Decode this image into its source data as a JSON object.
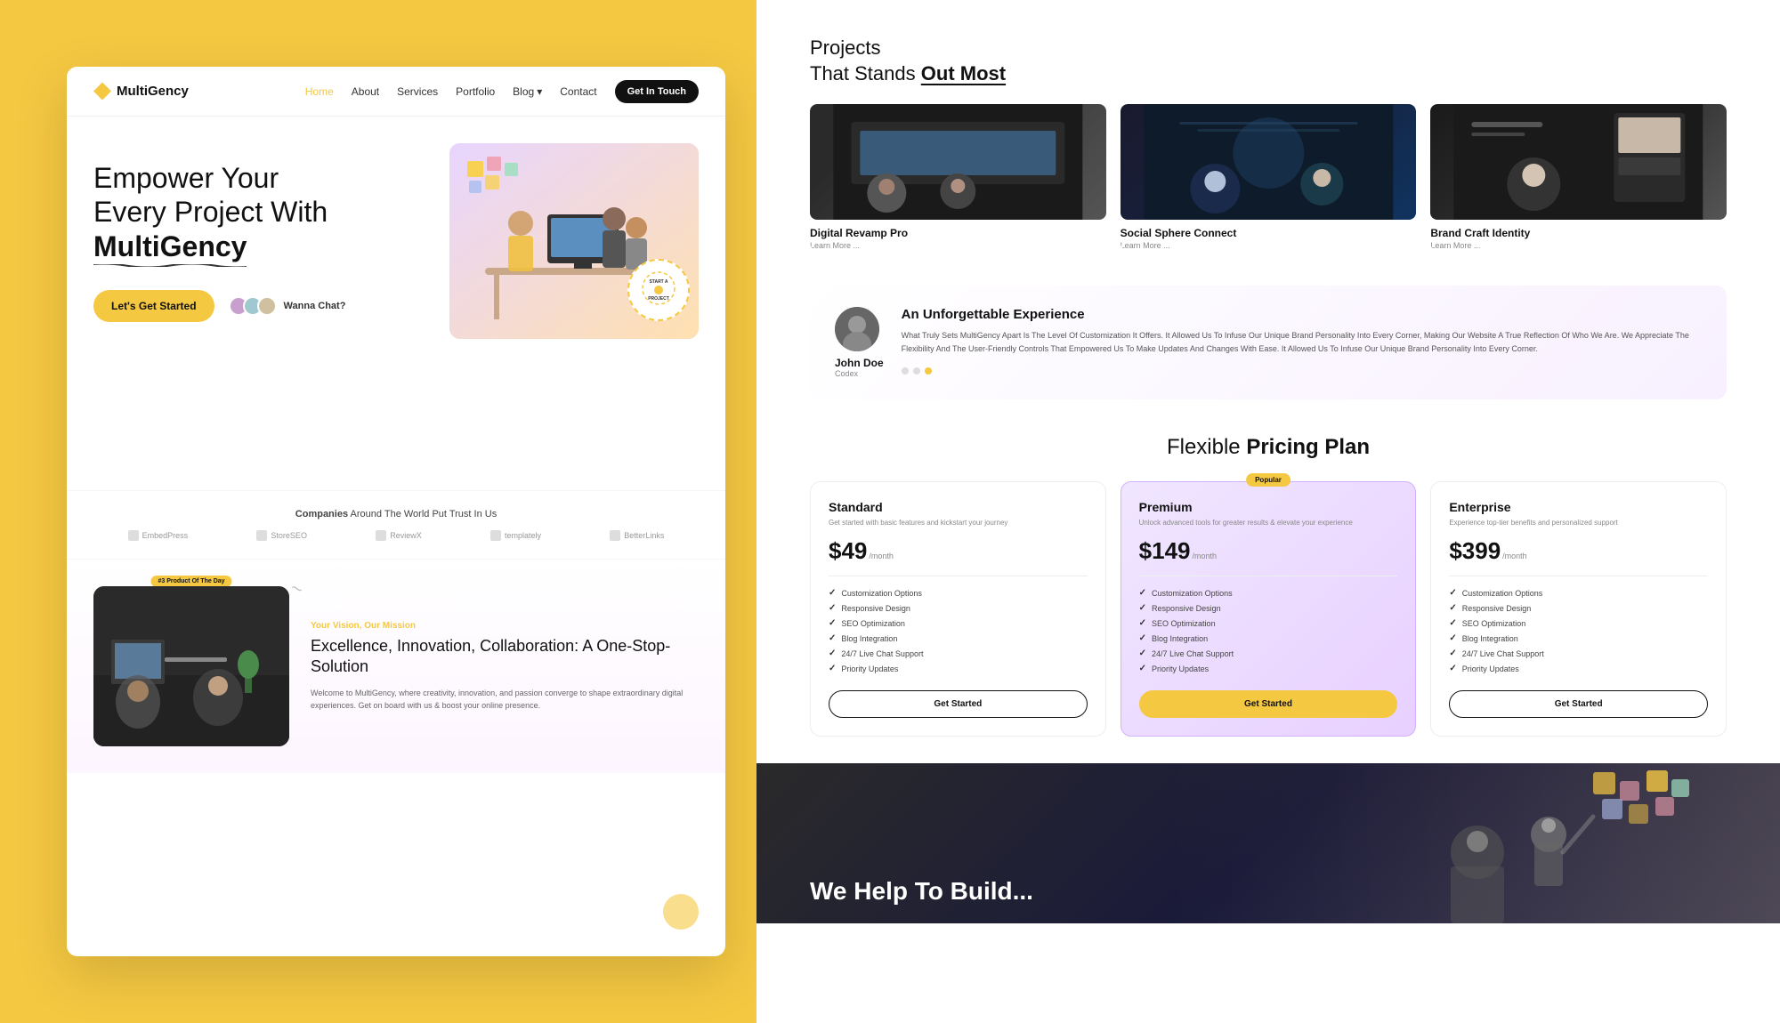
{
  "nav": {
    "logo": "MultiGency",
    "links": [
      "Home",
      "About",
      "Services",
      "Portfolio",
      "Blog",
      "Contact"
    ],
    "cta": "Get In Touch"
  },
  "hero": {
    "title_line1": "Empower Your",
    "title_line2": "Every Project With",
    "brand": "MultiGency",
    "badge_text": "START A PROJECT",
    "cta_primary": "Let's Get Started",
    "cta_secondary": "Wanna Chat?"
  },
  "trust": {
    "title_normal": "Companies Around The World Put",
    "title_bold": "Companies",
    "subtitle": "Around The World Put Trust In Us",
    "logos": [
      "EmbedPress",
      "StoreSEO",
      "ReviewX",
      "templately",
      "BetterLinks"
    ]
  },
  "about": {
    "badge": "#3 Product Of The Day",
    "label": "Your Vision, Our Mission",
    "title": "Excellence, Innovation, Collaboration: A One-Stop-Solution",
    "description": "Welcome to MultiGency, where creativity, innovation, and passion converge to shape extraordinary digital experiences. Get on board with us & boost your online presence."
  },
  "projects": {
    "heading_normal": "Projects",
    "heading_line2_normal": "That Stands",
    "heading_line2_bold": "Out Most",
    "items": [
      {
        "name": "Digital Revamp Pro",
        "link": "Learn More ..."
      },
      {
        "name": "Social Sphere Connect",
        "link": "Learn More ..."
      },
      {
        "name": "Brand Craft Identity",
        "link": "Learn More ..."
      }
    ]
  },
  "testimonial": {
    "name": "John Doe",
    "role": "Codex",
    "title": "An Unforgettable Experience",
    "text": "What Truly Sets MultiGency Apart Is The Level Of Customization It Offers. It Allowed Us To Infuse Our Unique Brand Personality Into Every Corner, Making Our Website A True Reflection Of Who We Are. We Appreciate The Flexibility And The User-Friendly Controls That Empowered Us To Make Updates And Changes With Ease. It Allowed Us To Infuse Our Unique Brand Personality Into Every Corner.",
    "dots": [
      false,
      false,
      true
    ]
  },
  "pricing": {
    "title_normal": "Flexible",
    "title_bold": "Pricing Plan",
    "plans": [
      {
        "name": "Standard",
        "desc": "Get started with basic features and kickstart your journey",
        "price": "$49",
        "period": "/month",
        "featured": false,
        "features": [
          "Customization Options",
          "Responsive Design",
          "SEO Optimization",
          "Blog Integration",
          "24/7 Live Chat Support",
          "Priority Updates"
        ],
        "cta": "Get Started"
      },
      {
        "name": "Premium",
        "desc": "Unlock advanced tools for greater results & elevate your experience",
        "price": "$149",
        "period": "/month",
        "featured": true,
        "popular": "Popular",
        "features": [
          "Customization Options",
          "Responsive Design",
          "SEO Optimization",
          "Blog Integration",
          "24/7 Live Chat Support",
          "Priority Updates"
        ],
        "cta": "Get Started"
      },
      {
        "name": "Enterprise",
        "desc": "Experience top-tier benefits and personalized support",
        "price": "$399",
        "period": "/month",
        "featured": false,
        "features": [
          "Customization Options",
          "Responsive Design",
          "SEO Optimization",
          "Blog Integration",
          "24/7 Live Chat Support",
          "Priority Updates"
        ],
        "cta": "Get Started"
      }
    ]
  },
  "bottom": {
    "text": "We Help To Build..."
  }
}
